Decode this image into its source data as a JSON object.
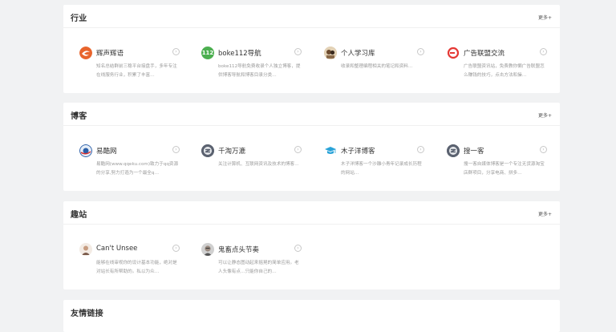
{
  "sections": [
    {
      "title": "行业",
      "more": "更多+",
      "items": [
        {
          "name": "辉声辉语",
          "desc": "知名总结群前三稳平台接盘手，多年专注在线服务行业，积累了丰富…",
          "logo_icon": "orange-swirl-logo-icon",
          "logo_color": "#e8642c"
        },
        {
          "name": "boke112导航",
          "desc": "boke112导航免费收录个人独立博客，提供博客导航和博客目录分类…",
          "logo_icon": "green-112-logo-icon",
          "logo_text": "112",
          "logo_color": "#4caf50"
        },
        {
          "name": "个人学习库",
          "desc": "收录和整理编程相关的笔记和资料…",
          "logo_icon": "avatar-logo-icon",
          "logo_color": "#7a5a3a"
        },
        {
          "name": "广告联盟交流",
          "desc": "广告联盟资讯站，免费教你懒广告联盟怎么赚钱的技巧，点击方法和操…",
          "logo_icon": "red-ring-logo-icon",
          "logo_color": "#e53935"
        }
      ]
    },
    {
      "title": "博客",
      "more": "更多+",
      "items": [
        {
          "name": "易酷网",
          "desc": "易酷网(www.qqeku.com)致力于qq资源的分享,努力打造为一个最全q…",
          "logo_icon": "blue-globe-logo-icon",
          "logo_color": "#2a5ea8"
        },
        {
          "name": "千淘万漉",
          "desc": "关注计算机、互联网资讯及技术的博客…",
          "logo_icon": "gray-placeholder-logo-icon",
          "logo_color": "#5b6270"
        },
        {
          "name": "木子洋博客",
          "desc": "木子洋博客一个沙雕小青年记录成长历程的网站…",
          "logo_icon": "graduation-cap-logo-icon",
          "logo_color": "#2aa3d8"
        },
        {
          "name": "搜一客",
          "desc": "搜一客自媒体博客是一个专注无货源淘宝店群项目，分享电商、拼多…",
          "logo_icon": "gray-placeholder-logo-icon",
          "logo_color": "#5b6270"
        }
      ]
    },
    {
      "title": "趣站",
      "more": "更多+",
      "items": [
        {
          "name": "Can't Unsee",
          "desc": "能够在线审视你的设计基本功能，绝对是对站长有所帮助的。私以为众…",
          "logo_icon": "person-avatar-logo-icon",
          "logo_color": "#c8a892"
        },
        {
          "name": "鬼畜点头节奏",
          "desc": "可以让静态图动起来摇晃的简单应用。老人头像有点…只能你自己的…",
          "logo_icon": "old-man-avatar-logo-icon",
          "logo_color": "#8a8a8a"
        }
      ]
    },
    {
      "title": "友情链接",
      "more": "",
      "items": []
    }
  ],
  "colors": {
    "page_background": "#f1f2f3",
    "card_background": "#ffffff",
    "description_text": "#9a9a9a"
  }
}
